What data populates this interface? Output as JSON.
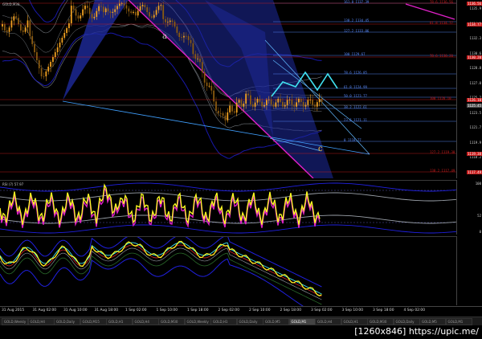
{
  "chart": {
    "symbol_label": "GOLD,M30",
    "wave_labels": {
      "a": "a",
      "c": "c"
    },
    "colors": {
      "background": "#000000",
      "bull_candle": "#f0a020",
      "bear_candle": "#8a5a10",
      "fib_blue": "#5a8cff",
      "fib_red": "#c81e1e",
      "wave_fill": "#1e2a9c",
      "magenta": "#e020c8",
      "cyan": "#40e0f0",
      "rsi_line": "#ffff20",
      "band_blue": "#2020e0",
      "band_gray": "#9aa0a8"
    },
    "price_axis": [
      "1135.9",
      "1134.1",
      "1132.3",
      "1130.6",
      "1128.8",
      "1127.0",
      "1125.2",
      "1123.5",
      "1121.7",
      "1119.9",
      "1118.2",
      "1116.4"
    ],
    "highlight_prices": [
      {
        "value": "1136.56",
        "color": "#c81e1e"
      },
      {
        "value": "1134.77",
        "color": "#c81e1e"
      },
      {
        "value": "1130.20",
        "color": "#c81e1e"
      },
      {
        "value": "1126.10",
        "color": "#c81e1e"
      },
      {
        "value": "1125.45",
        "color": "#555555"
      },
      {
        "value": "1119.38",
        "color": "#c81e1e"
      },
      {
        "value": "1117.49",
        "color": "#c81e1e"
      }
    ],
    "fib_blue_levels": [
      "161.8 1137.39",
      "138.2 1134.45",
      "127.2 1133.06",
      "100 1129.67",
      "78.6 1126.85",
      "61.8 1124.99",
      "50.0 1123.77",
      "38.2 1122.61",
      "23.6 1121.11",
      "0 1118.77"
    ],
    "fib_red_levels": [
      "78.6 1136.56",
      "61.8 1134.77",
      "78.6 1130.20",
      "100 1126.10",
      "127.2 1119.38",
      "138.2 1117.49"
    ],
    "rsi": {
      "title": "RSI (7) 57.97",
      "axis": [
        "100",
        "52",
        "0"
      ]
    },
    "time_axis": [
      "31 Aug 2015",
      "31 Aug 02:00",
      "31 Aug 10:00",
      "31 Aug 18:00",
      "1 Sep 02:00",
      "1 Sep 10:00",
      "1 Sep 18:00",
      "2 Sep 02:00",
      "2 Sep 10:00",
      "2 Sep 18:00",
      "3 Sep 02:00",
      "3 Sep 10:00",
      "3 Sep 18:00",
      "4 Sep 02:00"
    ],
    "tabs": [
      "GOLD,Weekly",
      "GOLD,H4",
      "GOLD,Daily",
      "GOLD,M15",
      "GOLD,H1",
      "GOLD,H4",
      "GOLD,M30",
      "GOLD,Weekly",
      "GOLD,H1",
      "GOLD,Daily",
      "GOLD,M5",
      "GOLD,M1",
      "GOLD,H4",
      "GOLD,H1",
      "GOLD,M30",
      "GOLD,Daily",
      "GOLD,M5",
      "GOLD,M1"
    ],
    "active_tab_index": 11,
    "watermark": "[1260x846] https://upic.me/"
  }
}
